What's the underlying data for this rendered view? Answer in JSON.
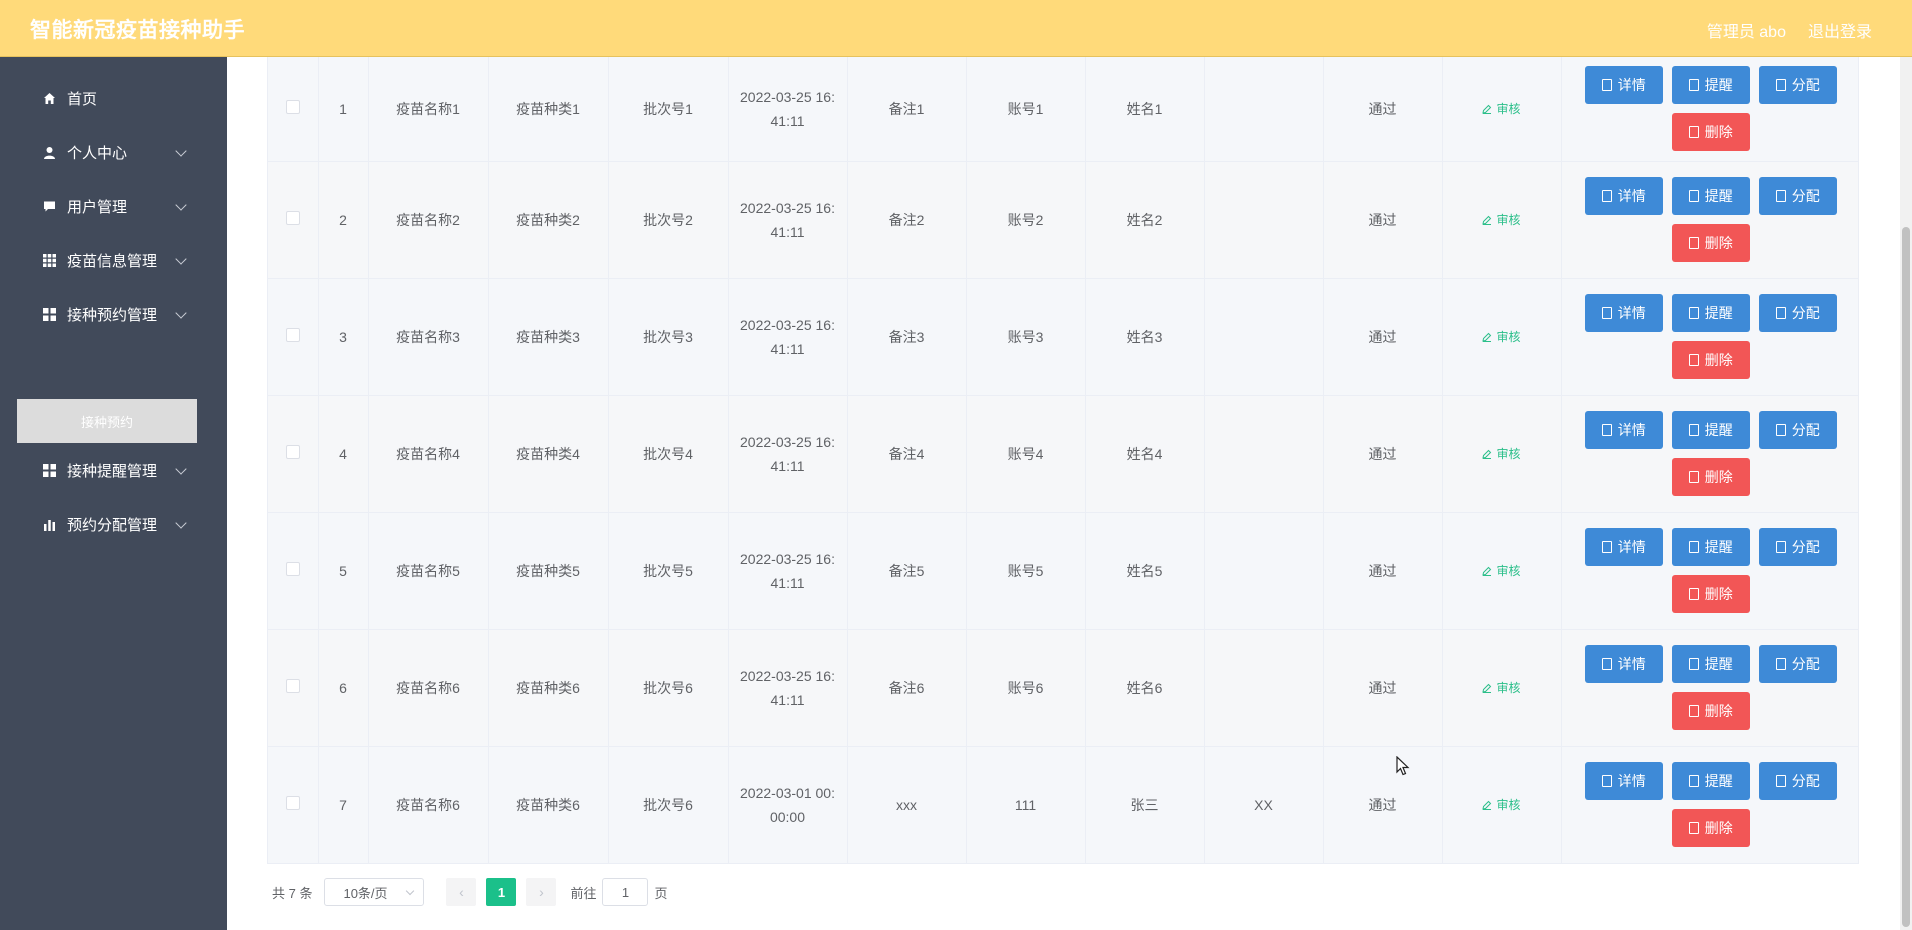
{
  "app": {
    "title": "智能新冠疫苗接种助手"
  },
  "header": {
    "user": "管理员 abo",
    "logout": "退出登录"
  },
  "sidebar": {
    "items": [
      {
        "label": "首页",
        "icon": "home-icon"
      },
      {
        "label": "个人中心",
        "icon": "user-icon"
      },
      {
        "label": "用户管理",
        "icon": "chat-icon"
      },
      {
        "label": "疫苗信息管理",
        "icon": "grid-icon"
      },
      {
        "label": "接种预约管理",
        "icon": "apps-icon"
      },
      {
        "label": "接种提醒管理",
        "icon": "apps-icon"
      },
      {
        "label": "预约分配管理",
        "icon": "chart-icon"
      }
    ],
    "active_sub": "接种预约"
  },
  "table": {
    "review_label": "审核",
    "buttons": {
      "detail": "详情",
      "remind": "提醒",
      "assign": "分配",
      "delete": "删除"
    },
    "rows": [
      {
        "idx": "1",
        "name": "疫苗名称1",
        "type": "疫苗种类1",
        "batch": "批次号1",
        "time": "2022-03-25 16:41:11",
        "remark": "备注1",
        "account": "账号1",
        "realname": "姓名1",
        "extra": "",
        "status": "通过"
      },
      {
        "idx": "2",
        "name": "疫苗名称2",
        "type": "疫苗种类2",
        "batch": "批次号2",
        "time": "2022-03-25 16:41:11",
        "remark": "备注2",
        "account": "账号2",
        "realname": "姓名2",
        "extra": "",
        "status": "通过"
      },
      {
        "idx": "3",
        "name": "疫苗名称3",
        "type": "疫苗种类3",
        "batch": "批次号3",
        "time": "2022-03-25 16:41:11",
        "remark": "备注3",
        "account": "账号3",
        "realname": "姓名3",
        "extra": "",
        "status": "通过"
      },
      {
        "idx": "4",
        "name": "疫苗名称4",
        "type": "疫苗种类4",
        "batch": "批次号4",
        "time": "2022-03-25 16:41:11",
        "remark": "备注4",
        "account": "账号4",
        "realname": "姓名4",
        "extra": "",
        "status": "通过"
      },
      {
        "idx": "5",
        "name": "疫苗名称5",
        "type": "疫苗种类5",
        "batch": "批次号5",
        "time": "2022-03-25 16:41:11",
        "remark": "备注5",
        "account": "账号5",
        "realname": "姓名5",
        "extra": "",
        "status": "通过"
      },
      {
        "idx": "6",
        "name": "疫苗名称6",
        "type": "疫苗种类6",
        "batch": "批次号6",
        "time": "2022-03-25 16:41:11",
        "remark": "备注6",
        "account": "账号6",
        "realname": "姓名6",
        "extra": "",
        "status": "通过"
      },
      {
        "idx": "7",
        "name": "疫苗名称6",
        "type": "疫苗种类6",
        "batch": "批次号6",
        "time": "2022-03-01 00:00:00",
        "remark": "xxx",
        "account": "111",
        "realname": "张三",
        "extra": "XX",
        "status": "通过"
      }
    ]
  },
  "pagination": {
    "total": "共 7 条",
    "page_size": "10条/页",
    "current_page": "1",
    "goto_label": "前往",
    "goto_value": "1",
    "page_unit": "页"
  },
  "colors": {
    "header_bg": "#ffda7a",
    "sidebar_bg": "#414a5a",
    "primary_button": "#3e8ad7",
    "danger_button": "#f25656",
    "active_page": "#1bc08a",
    "review_link": "#2bbf8a"
  }
}
